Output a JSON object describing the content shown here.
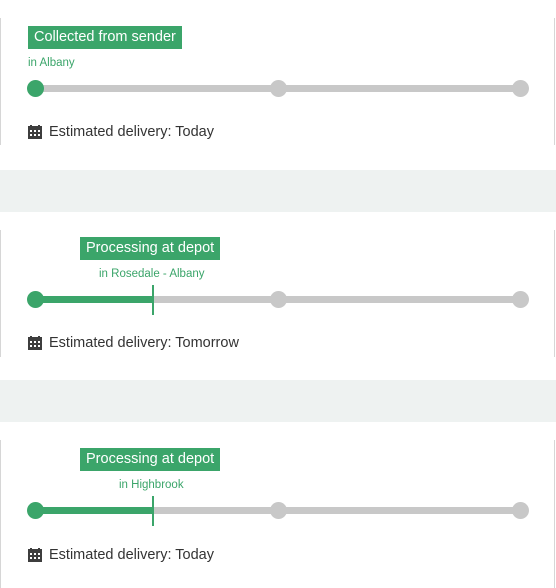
{
  "shipments": [
    {
      "status": "Collected from sender",
      "location": "in Albany",
      "eta_label": "Estimated delivery: Today",
      "progress": 0.0
    },
    {
      "status": "Processing at depot",
      "location": "in Rosedale - Albany",
      "eta_label": "Estimated delivery: Tomorrow",
      "progress": 0.24
    },
    {
      "status": "Processing at depot",
      "location": "in Highbrook",
      "eta_label": "Estimated delivery: Today",
      "progress": 0.24
    }
  ],
  "icons": {
    "eta": "calendar-icon"
  },
  "colors": {
    "accent": "#3ba56a",
    "track": "#c8c8c8",
    "gap": "#eef2f1",
    "text": "#333333"
  }
}
